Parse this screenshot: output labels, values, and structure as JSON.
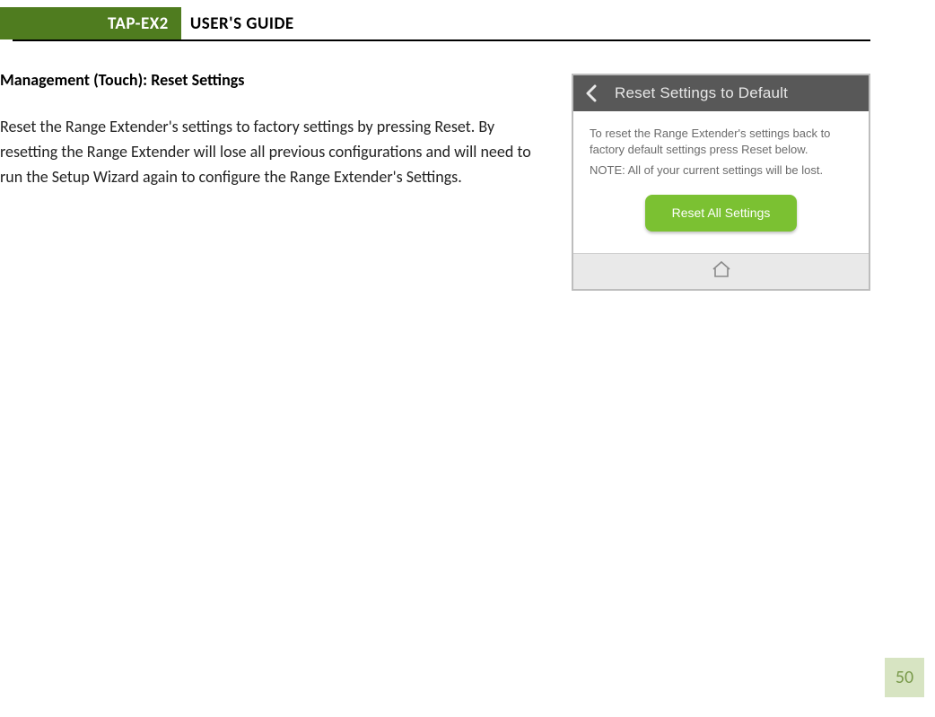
{
  "header": {
    "badge": "TAP-EX2",
    "title": "USER'S GUIDE"
  },
  "section": {
    "title": "Management (Touch): Reset Settings",
    "body": "Reset the Range Extender's settings to factory settings by pressing Reset.  By resetting the Range Extender will lose all previous configurations and will need to run the Setup Wizard again to configure the Range Extender's Settings."
  },
  "screenshot": {
    "title": "Reset Settings to Default",
    "line1": "To reset the Range Extender's settings back to factory default settings press Reset below.",
    "note": "NOTE: All of your current settings will be lost.",
    "button": "Reset All Settings"
  },
  "page_number": "50"
}
